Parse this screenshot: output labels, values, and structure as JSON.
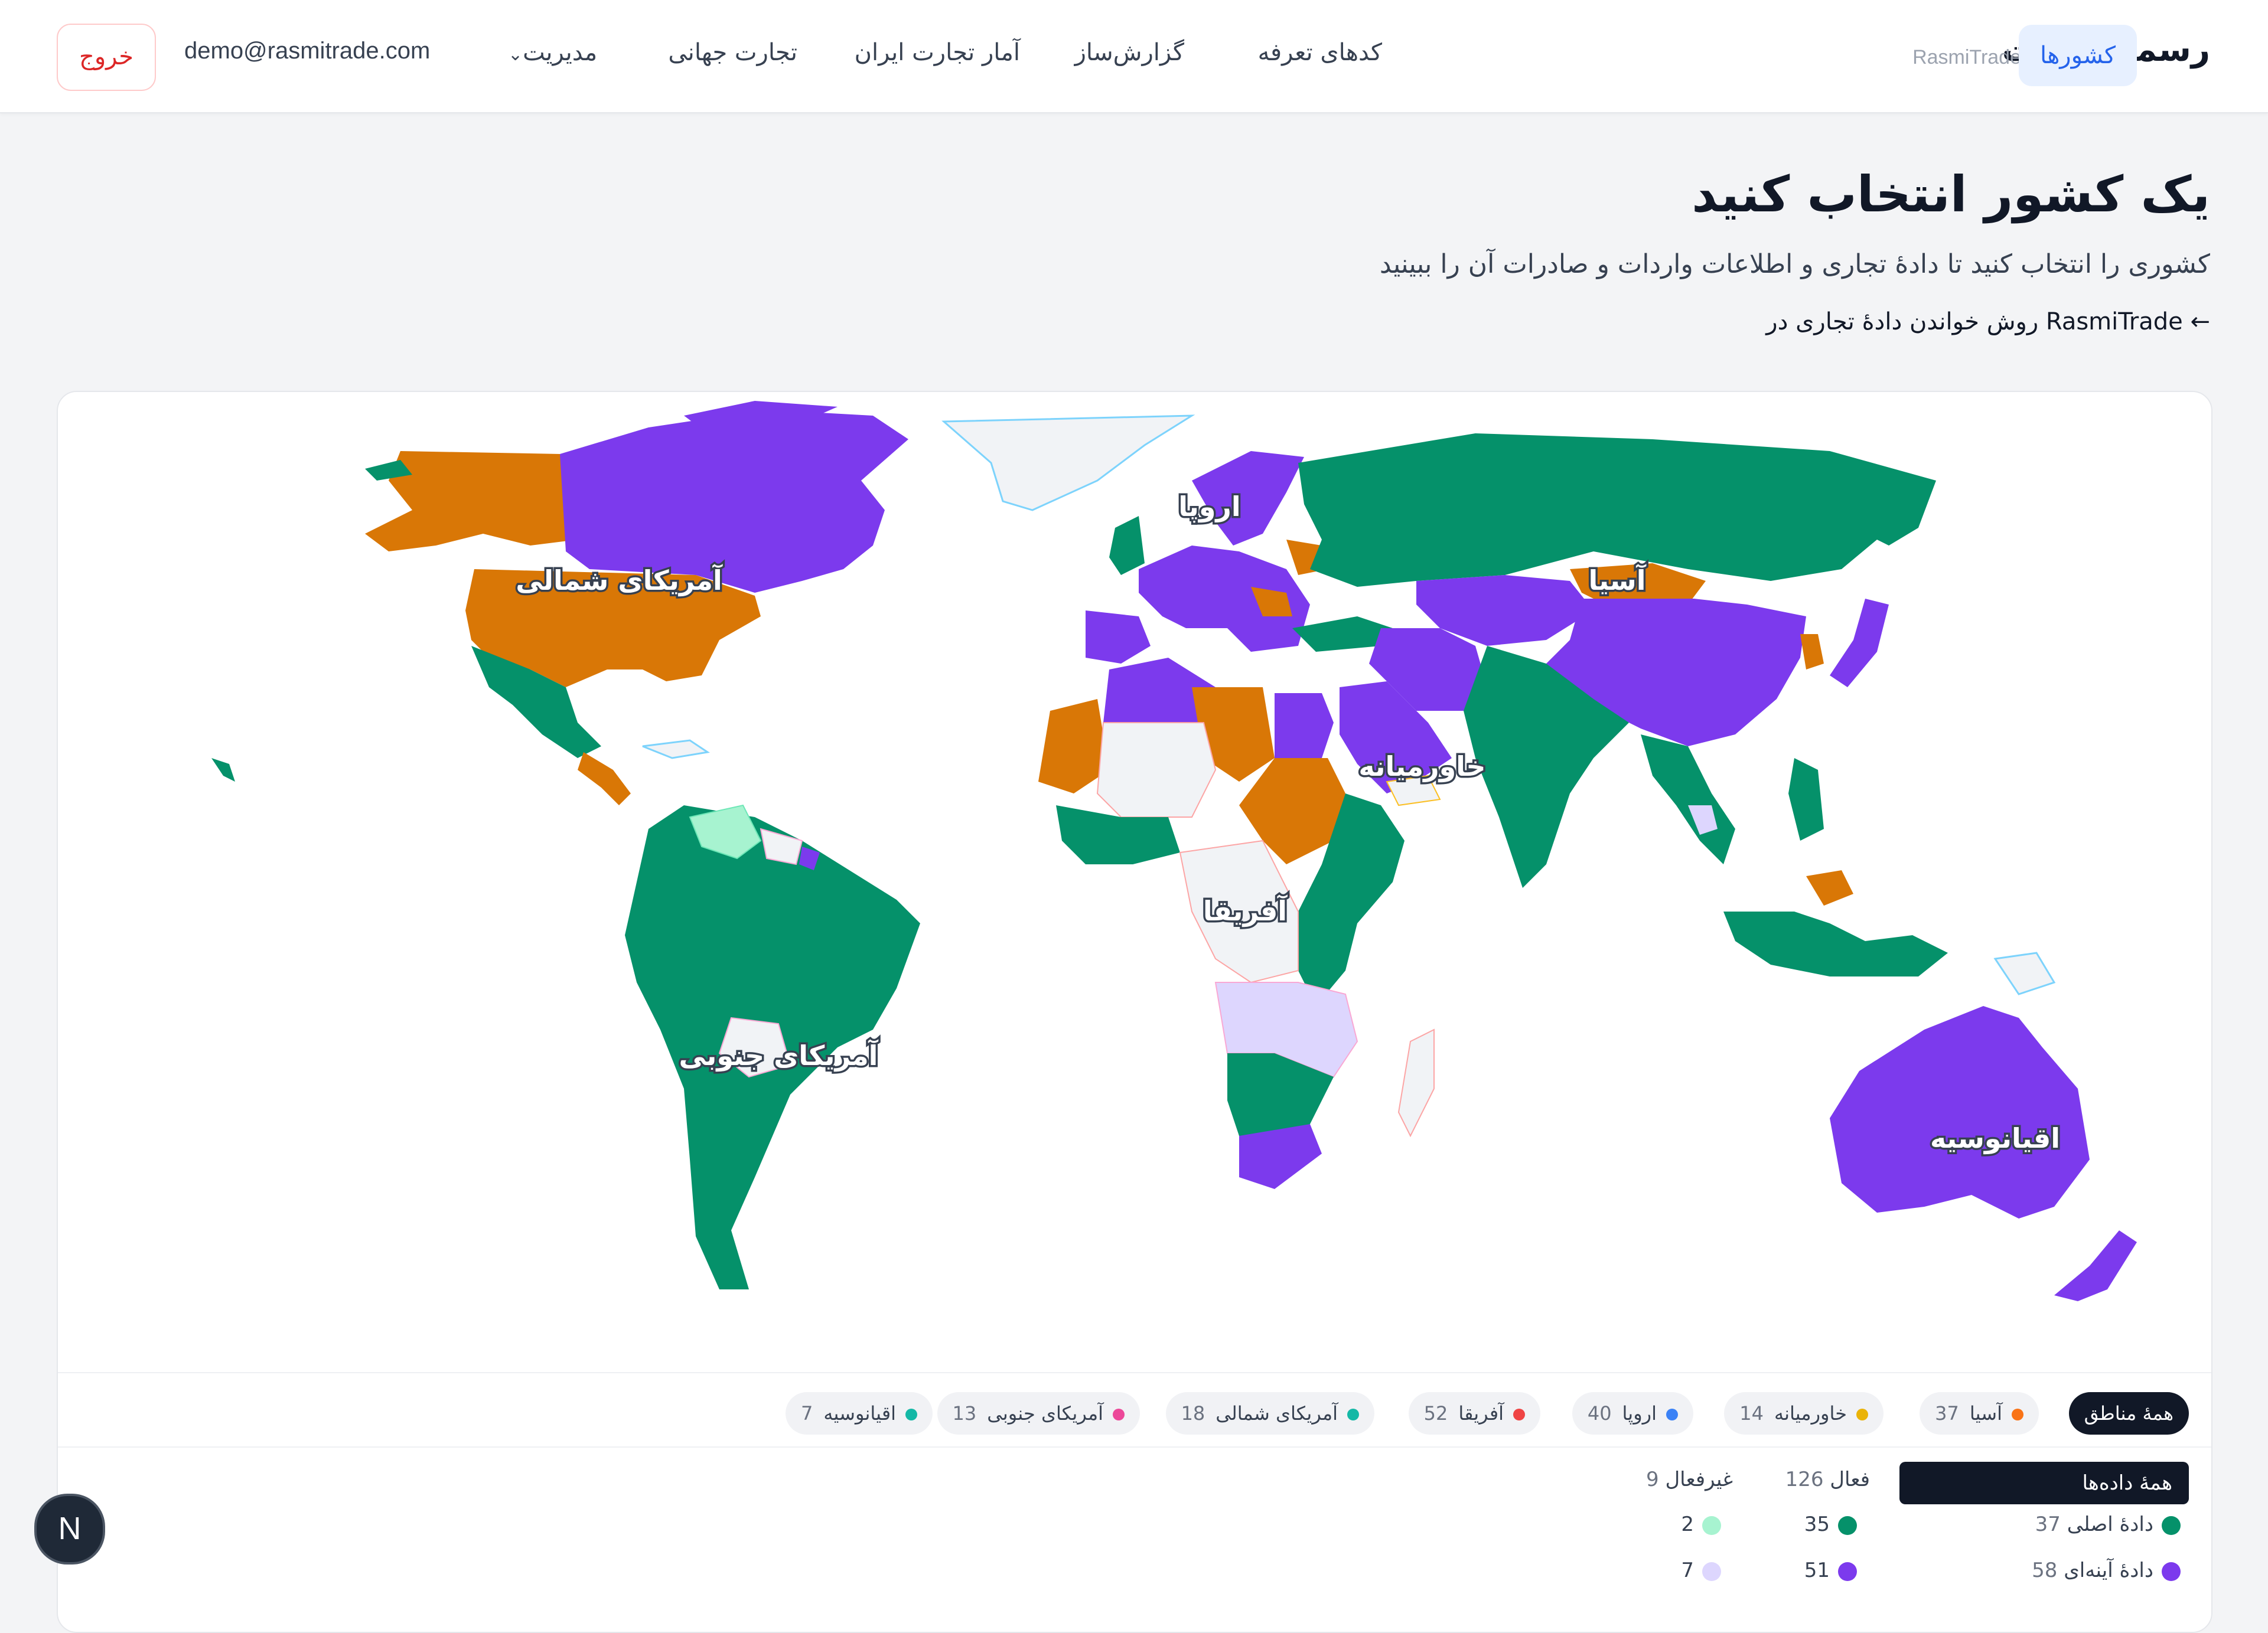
{
  "header": {
    "brand_fa": "رسمی‌تجارت",
    "brand_en": "RasmiTrade",
    "nav": {
      "countries": "کشورها",
      "tariff_codes": "کدهای تعرفه",
      "report_builder": "گزارش‌ساز",
      "iran_trade_stats": "آمار تجارت ایران",
      "world_trade": "تجارت جهانی",
      "management": "مدیریت"
    },
    "user_email": "demo@rasmitrade.com",
    "logout": "خروج"
  },
  "page": {
    "title": "یک کشور انتخاب کنید",
    "subtitle": "کشوری را انتخاب کنید تا دادهٔ تجاری و اطلاعات واردات و صادرات آن را ببینید",
    "guide_link": "روش خواندن دادهٔ تجاری در RasmiTrade ←"
  },
  "map": {
    "labels": {
      "north_america": "آمریکای شمالی",
      "south_america": "آمریکای جنوبی",
      "europe": "اروپا",
      "africa": "آفریقا",
      "middle_east": "خاورمیانه",
      "asia": "آسیا",
      "oceania": "اقیانوسیه"
    },
    "colors": {
      "primary": "#05916a",
      "mirror": "#7c3aed",
      "partial": "#d97706",
      "inactive_primary": "#a7f3d0",
      "inactive_mirror": "#ddd6fe",
      "none": "#f1f3f6"
    }
  },
  "regions": {
    "all": "همهٔ مناطق",
    "items": [
      {
        "name": "آسیا",
        "count": "37",
        "color": "#f97316"
      },
      {
        "name": "خاورمیانه",
        "count": "14",
        "color": "#eab308"
      },
      {
        "name": "اروپا",
        "count": "40",
        "color": "#3b82f6"
      },
      {
        "name": "آفریقا",
        "count": "52",
        "color": "#ef4444"
      },
      {
        "name": "آمریکای شمالی",
        "count": "18",
        "color": "#14b8a6"
      },
      {
        "name": "آمریکای جنوبی",
        "count": "13",
        "color": "#ec4899"
      },
      {
        "name": "اقیانوسیه",
        "count": "7",
        "color": "#14b8a6"
      }
    ]
  },
  "stats": {
    "all_data": "همهٔ داده‌ها",
    "active_label": "فعال",
    "active_total": "126",
    "inactive_label": "غیرفعال",
    "inactive_total": "9",
    "rows": [
      {
        "label": "دادهٔ اصلی",
        "count": "37",
        "active": "35",
        "inactive": "2",
        "color": "#05916a",
        "inactive_color": "#a7f3d0"
      },
      {
        "label": "دادهٔ آینه‌ای",
        "count": "58",
        "active": "51",
        "inactive": "7",
        "color": "#7c3aed",
        "inactive_color": "#ddd6fe"
      }
    ]
  },
  "badge": "N"
}
